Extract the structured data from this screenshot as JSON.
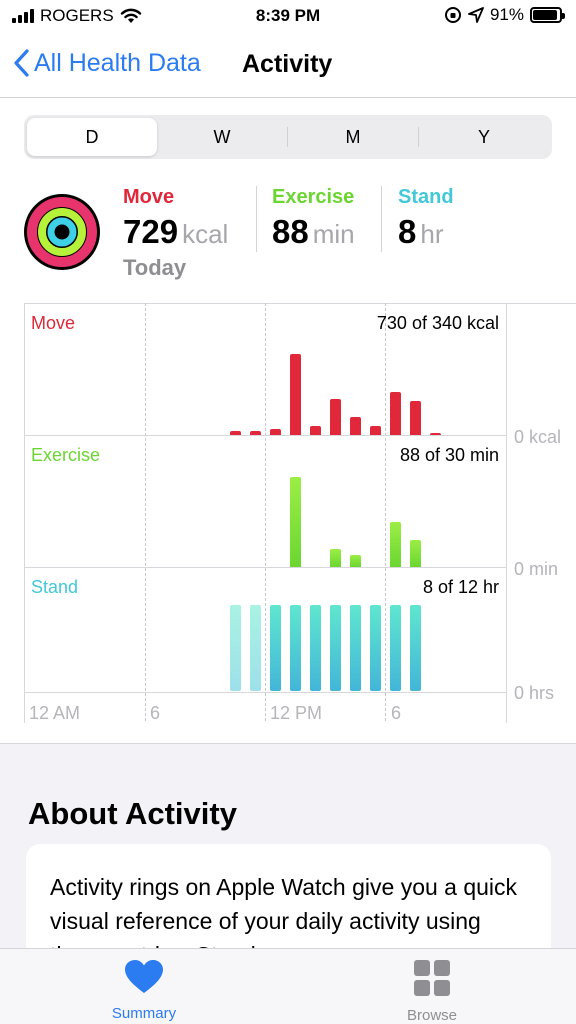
{
  "status_bar": {
    "carrier": "ROGERS",
    "time": "8:39 PM",
    "battery": "91%",
    "battery_level": 0.91
  },
  "nav": {
    "back_label": "All Health Data",
    "title": "Activity"
  },
  "segments": {
    "options": [
      "D",
      "W",
      "M",
      "Y"
    ],
    "selected": "D"
  },
  "summary": {
    "move": {
      "label": "Move",
      "value": "729",
      "unit": "kcal"
    },
    "exercise": {
      "label": "Exercise",
      "value": "88",
      "unit": "min"
    },
    "stand": {
      "label": "Stand",
      "value": "8",
      "unit": "hr"
    },
    "date_label": "Today"
  },
  "colors": {
    "move": "#e0283a",
    "exercise": "#6bd631",
    "stand": "#43c8d8",
    "accent": "#2b7bf1"
  },
  "chart_data": [
    {
      "type": "bar",
      "title": "Move",
      "goal_text": "730 of 340 kcal",
      "axis_min_label": "0 kcal",
      "x_ticks": [
        "12 AM",
        "6",
        "12 PM",
        "6"
      ],
      "x": [
        "10 AM",
        "11 AM",
        "12 PM",
        "1 PM",
        "2 PM",
        "3 PM",
        "4 PM",
        "5 PM",
        "6 PM",
        "7 PM",
        "8 PM"
      ],
      "values": [
        5,
        5,
        7,
        90,
        10,
        40,
        20,
        10,
        48,
        38,
        1
      ],
      "ylim": [
        0,
        100
      ]
    },
    {
      "type": "bar",
      "title": "Exercise",
      "goal_text": "88 of 30 min",
      "axis_min_label": "0 min",
      "x": [
        "1 PM",
        "3 PM",
        "4 PM",
        "6 PM",
        "7 PM"
      ],
      "values": [
        30,
        6,
        4,
        15,
        9
      ],
      "ylim": [
        0,
        30
      ]
    },
    {
      "type": "bar",
      "title": "Stand",
      "goal_text": "8 of 12 hr",
      "axis_min_label": "0 hrs",
      "x": [
        "10 AM",
        "11 AM",
        "12 PM",
        "1 PM",
        "2 PM",
        "3 PM",
        "4 PM",
        "5 PM",
        "6 PM",
        "7 PM"
      ],
      "values": [
        1,
        1,
        1,
        1,
        1,
        1,
        1,
        1,
        1,
        1
      ],
      "ylim": [
        0,
        1
      ]
    }
  ],
  "about": {
    "title": "About Activity",
    "text": "Activity rings on Apple Watch give you a quick visual reference of your daily activity using three metrics: Stand,"
  },
  "tabs": [
    {
      "label": "Summary",
      "icon": "heart-icon",
      "active": true
    },
    {
      "label": "Browse",
      "icon": "grid-icon",
      "active": false
    }
  ]
}
